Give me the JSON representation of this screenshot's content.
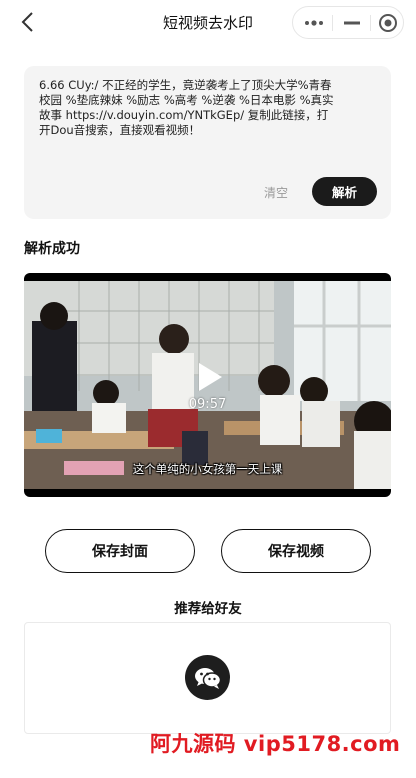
{
  "nav": {
    "title": "短视频去水印",
    "back_icon": "chevron-left-icon",
    "menu_icon": "more-dots-icon",
    "minimize_icon": "minimize-icon",
    "close_icon": "target-close-icon"
  },
  "input": {
    "text": "6.66 CUy:/ 不正经的学生，竟逆袭考上了顶尖大学%青春校园 %垫底辣妹 %励志 %高考 %逆袭 %日本电影 %真实故事  https://v.douyin.com/YNTkGEp/ 复制此链接，打开Dou音搜索，直接观看视频！",
    "clear_label": "清空",
    "parse_label": "解析"
  },
  "result": {
    "title": "解析成功",
    "video": {
      "duration": "09:57",
      "subtitle": "这个单纯的小女孩第一天上课",
      "play_icon": "play-icon"
    }
  },
  "actions": {
    "save_cover_label": "保存封面",
    "save_video_label": "保存视频"
  },
  "share": {
    "title": "推荐给好友",
    "wechat_icon": "wechat-icon"
  },
  "watermark": {
    "text": "阿九源码 vip5178.com",
    "color": "#e11b22"
  },
  "colors": {
    "primary_button": "#1b1b1b",
    "input_background": "#f4f4f4"
  }
}
